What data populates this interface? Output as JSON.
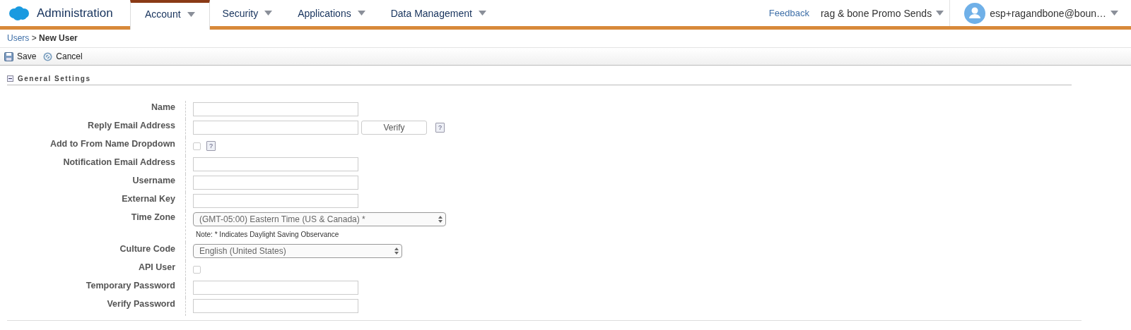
{
  "header": {
    "app_title": "Administration",
    "tabs": [
      {
        "label": "Account",
        "selected": true
      },
      {
        "label": "Security",
        "selected": false
      },
      {
        "label": "Applications",
        "selected": false
      },
      {
        "label": "Data Management",
        "selected": false
      }
    ],
    "feedback": "Feedback",
    "business_unit": "rag & bone Promo Sends",
    "user": "esp+ragandbone@boun…"
  },
  "breadcrumb": {
    "parent": "Users",
    "separator": ">",
    "current": "New User"
  },
  "toolbar": [
    "Save",
    "Cancel"
  ],
  "section": {
    "title": "General Settings",
    "expanded": true
  },
  "fields": [
    {
      "label": "Name",
      "kind": "text"
    },
    {
      "label": "Reply Email Address",
      "kind": "text",
      "button": "Verify",
      "help": "?"
    },
    {
      "label": "Add to From Name Dropdown",
      "kind": "checkbox",
      "checked": false,
      "help": "?"
    },
    {
      "label": "Notification Email Address",
      "kind": "text"
    },
    {
      "label": "Username",
      "kind": "text"
    },
    {
      "label": "External Key",
      "kind": "text"
    },
    {
      "label": "Time Zone",
      "kind": "select",
      "value": "(GMT-05:00) Eastern Time (US & Canada) *",
      "note": "Note: * Indicates Daylight Saving Observance",
      "wide": true
    },
    {
      "label": "Culture Code",
      "kind": "select",
      "value": "English (United States)",
      "wide": false
    },
    {
      "label": "API User",
      "kind": "checkbox",
      "checked": false
    },
    {
      "label": "Temporary Password",
      "kind": "text"
    },
    {
      "label": "Verify Password",
      "kind": "text"
    }
  ]
}
